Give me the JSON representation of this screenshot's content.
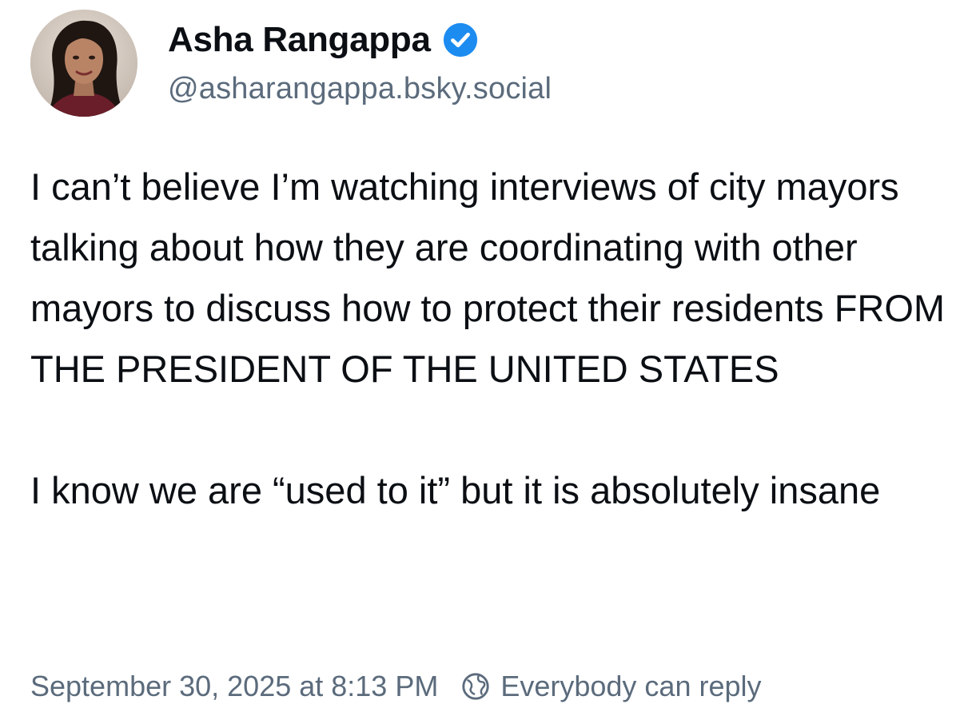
{
  "post": {
    "author": {
      "display_name": "Asha Rangappa",
      "handle": "@asharangappa.bsky.social",
      "verified_icon": "verified-check-icon",
      "avatar": "profile-photo"
    },
    "text_paragraphs": [
      "I can’t believe I’m watching interviews of city mayors talking about how they are coordinating with other mayors to discuss how to protect their residents FROM THE PRESIDENT OF THE UNITED STATES",
      "I know we are “used to it” but it is absolutely insane"
    ],
    "timestamp": "September 30, 2025 at 8:13 PM",
    "reply_setting": {
      "icon": "globe-icon",
      "label": "Everybody can reply"
    }
  },
  "colors": {
    "text": "#0b0f14",
    "muted": "#5b6b7c",
    "verified_blue": "#1d8cf0",
    "background": "#ffffff"
  }
}
